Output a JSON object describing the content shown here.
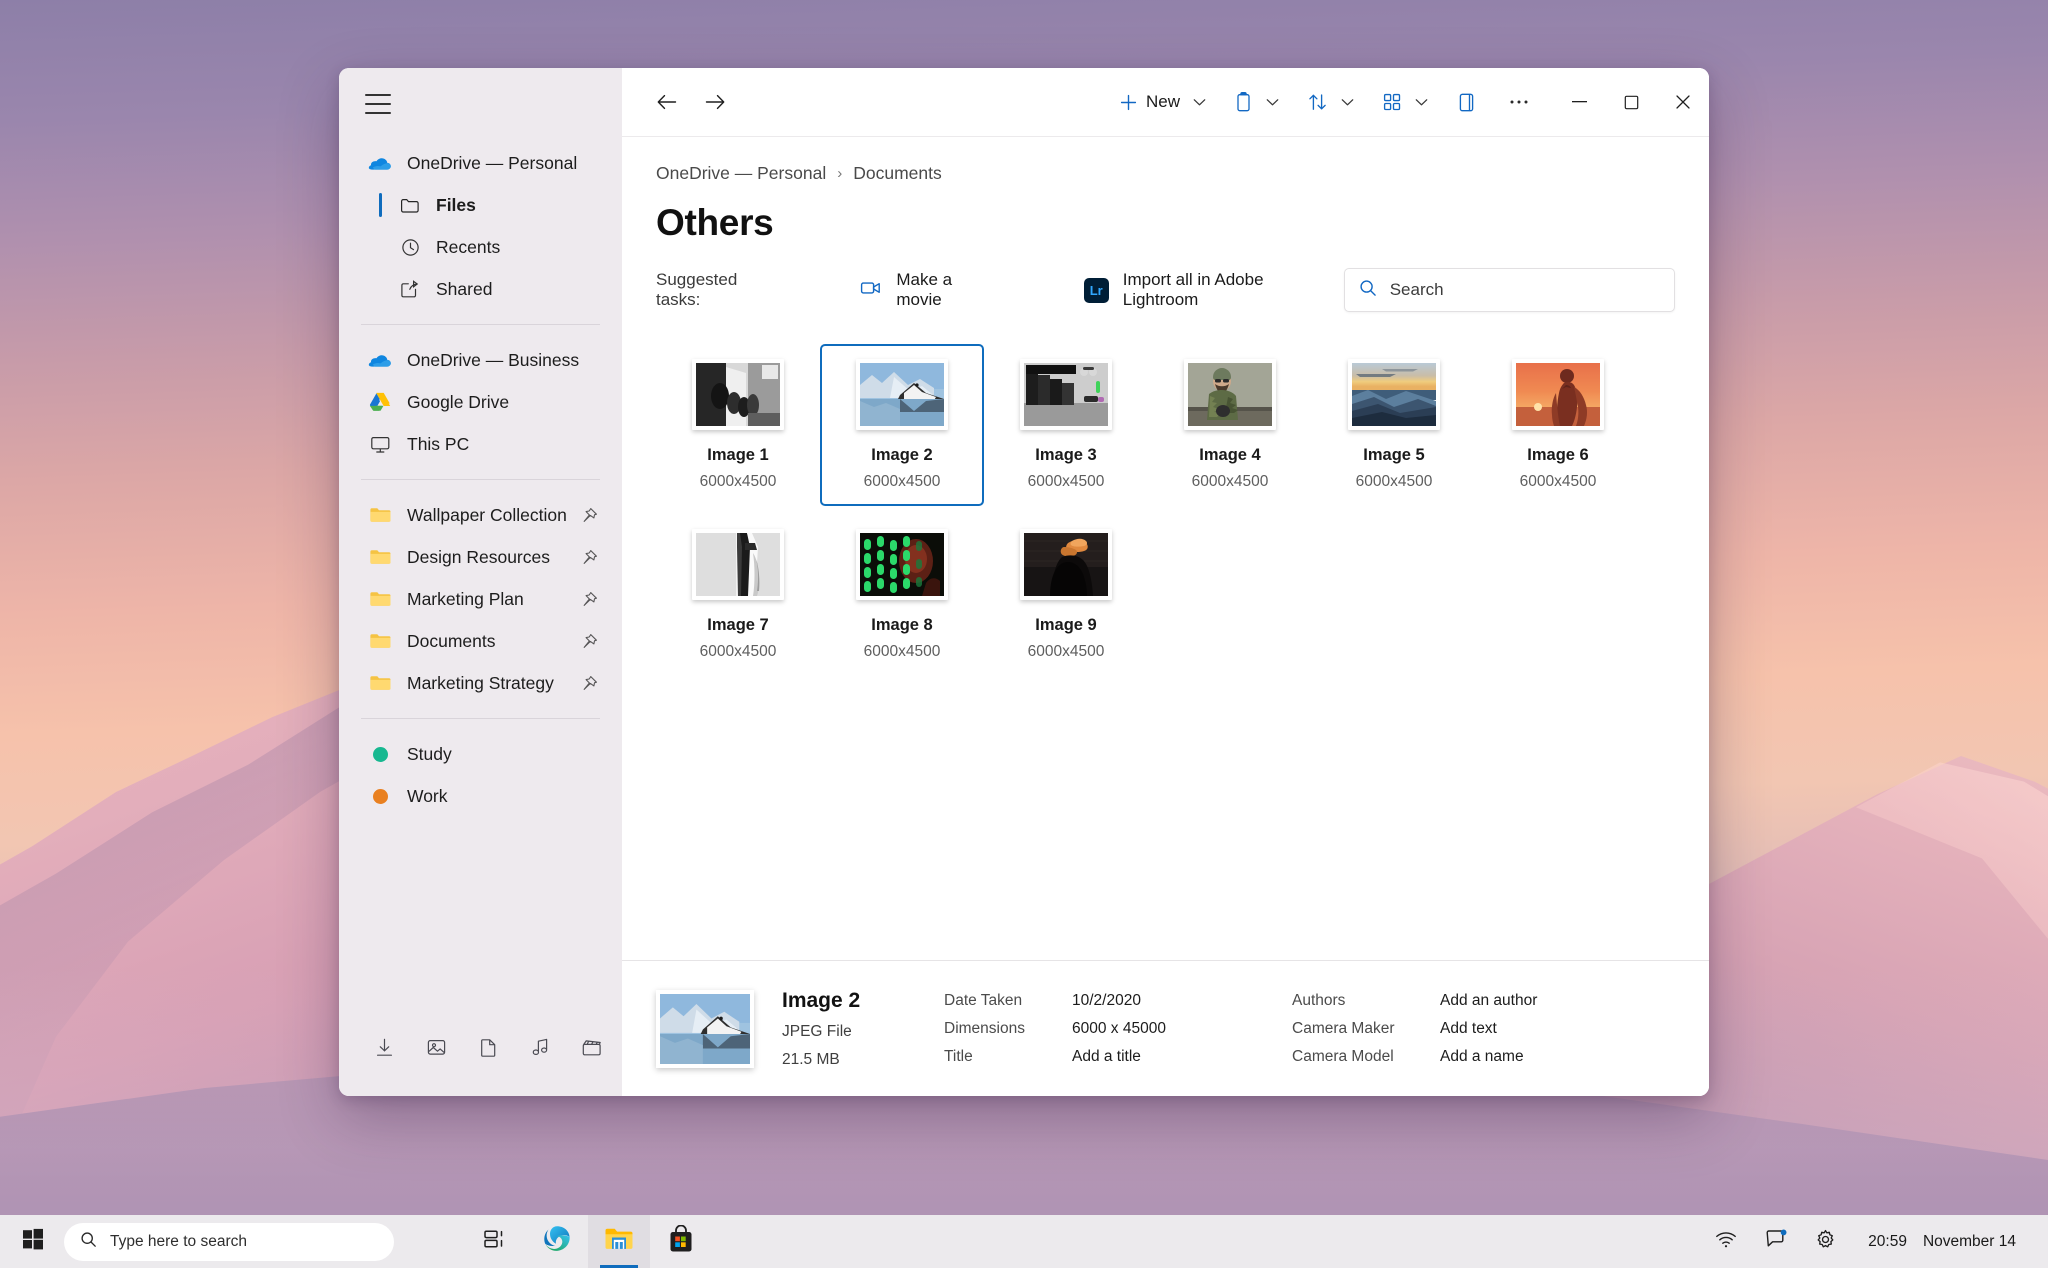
{
  "window": {
    "nav": {
      "back": "back-arrow",
      "forward": "forward-arrow"
    },
    "commands": [
      {
        "id": "new",
        "label": "New",
        "icon": "plus-icon",
        "chevron": true
      },
      {
        "id": "paste",
        "label": "",
        "icon": "clipboard-icon",
        "chevron": true
      },
      {
        "id": "sort",
        "label": "",
        "icon": "sort-icon",
        "chevron": true
      },
      {
        "id": "view",
        "label": "",
        "icon": "view-grid-icon",
        "chevron": true
      },
      {
        "id": "details-pane",
        "label": "",
        "icon": "details-pane-icon",
        "chevron": false
      },
      {
        "id": "more",
        "label": "",
        "icon": "ellipsis-icon",
        "chevron": false
      }
    ],
    "caption": {
      "minimize": "minimize-icon",
      "maximize": "maximize-icon",
      "close": "close-icon"
    }
  },
  "sidebar": {
    "menu_icon": "hamburger-icon",
    "account": {
      "label": "OneDrive — Personal",
      "icon": "onedrive-icon"
    },
    "account_children": [
      {
        "label": "Files",
        "icon": "folder-outline-icon",
        "selected": true
      },
      {
        "label": "Recents",
        "icon": "clock-icon",
        "selected": false
      },
      {
        "label": "Shared",
        "icon": "share-icon",
        "selected": false
      }
    ],
    "drives": [
      {
        "label": "OneDrive — Business",
        "icon": "onedrive-icon"
      },
      {
        "label": "Google Drive",
        "icon": "google-drive-icon"
      },
      {
        "label": "This PC",
        "icon": "monitor-icon"
      }
    ],
    "pinned_folders": [
      {
        "label": "Wallpaper Collection",
        "icon": "folder-icon",
        "pin": "pin-icon"
      },
      {
        "label": "Design Resources",
        "icon": "folder-icon",
        "pin": "pin-icon"
      },
      {
        "label": "Marketing Plan",
        "icon": "folder-icon",
        "pin": "pin-icon"
      },
      {
        "label": "Documents",
        "icon": "folder-icon",
        "pin": "pin-icon"
      },
      {
        "label": "Marketing Strategy",
        "icon": "folder-icon",
        "pin": "pin-icon"
      }
    ],
    "tags": [
      {
        "label": "Study",
        "color": "#17b890"
      },
      {
        "label": "Work",
        "color": "#e98020"
      }
    ],
    "quick_icons": [
      "download-icon",
      "pictures-icon",
      "documents-icon",
      "music-icon",
      "videos-icon"
    ]
  },
  "main": {
    "breadcrumb": [
      "OneDrive — Personal",
      "Documents"
    ],
    "breadcrumb_separator": "›",
    "title": "Others",
    "suggested_tasks_label": "Suggested tasks:",
    "tasks": [
      {
        "label": "Make a movie",
        "icon": "video-camera-icon"
      },
      {
        "label": "Import all in Adobe Lightroom",
        "icon": "lightroom-icon",
        "icon_text": "Lr"
      }
    ],
    "search": {
      "placeholder": "Search",
      "value": "",
      "icon": "search-icon"
    },
    "items": [
      {
        "name": "Image 1",
        "dimensions": "6000x4500",
        "selected": false,
        "thumb": "bw-crowd-street"
      },
      {
        "name": "Image 2",
        "dimensions": "6000x4500",
        "selected": true,
        "thumb": "snow-mountain-lake"
      },
      {
        "name": "Image 3",
        "dimensions": "6000x4500",
        "selected": false,
        "thumb": "bw-dark-seats"
      },
      {
        "name": "Image 4",
        "dimensions": "6000x4500",
        "selected": false,
        "thumb": "bearded-man-camo"
      },
      {
        "name": "Image 5",
        "dimensions": "6000x4500",
        "selected": false,
        "thumb": "blue-mountain-dusk"
      },
      {
        "name": "Image 6",
        "dimensions": "6000x4500",
        "selected": false,
        "thumb": "orange-sunset-silhouette"
      },
      {
        "name": "Image 7",
        "dimensions": "6000x4500",
        "selected": false,
        "thumb": "bw-tower"
      },
      {
        "name": "Image 8",
        "dimensions": "6000x4500",
        "selected": false,
        "thumb": "green-neon-portrait"
      },
      {
        "name": "Image 9",
        "dimensions": "6000x4500",
        "selected": false,
        "thumb": "dark-hat-silhouette"
      }
    ]
  },
  "details": {
    "thumb": "snow-mountain-lake",
    "name": "Image 2",
    "type": "JPEG File",
    "size": "21.5 MB",
    "fields_left": [
      {
        "key": "Date Taken",
        "value": "10/2/2020"
      },
      {
        "key": "Dimensions",
        "value": "6000 x 45000"
      },
      {
        "key": "Title",
        "value": "Add a title"
      }
    ],
    "fields_right": [
      {
        "key": "Authors",
        "value": "Add an author"
      },
      {
        "key": "Camera Maker",
        "value": "Add text"
      },
      {
        "key": "Camera Model",
        "value": "Add a name"
      }
    ]
  },
  "taskbar": {
    "start_icon": "windows-start-icon",
    "search": {
      "placeholder": "Type here to search",
      "value": "",
      "icon": "search-icon"
    },
    "apps": [
      {
        "id": "task-view",
        "icon": "task-view-icon",
        "active": false
      },
      {
        "id": "edge",
        "icon": "edge-icon",
        "active": false
      },
      {
        "id": "file-explorer",
        "icon": "file-explorer-icon",
        "active": true
      },
      {
        "id": "microsoft-store",
        "icon": "store-icon",
        "active": false
      }
    ],
    "tray": [
      {
        "id": "network",
        "icon": "wifi-icon"
      },
      {
        "id": "chat",
        "icon": "chat-icon",
        "badge": true
      },
      {
        "id": "settings",
        "icon": "gear-icon"
      }
    ],
    "time": "20:59",
    "date": "November 14"
  },
  "colors": {
    "accent": "#0f6cbd",
    "sidebar_bg": "#eeeaee",
    "taskbar_bg": "#eceaed",
    "selection_border": "#0f6cbd"
  }
}
